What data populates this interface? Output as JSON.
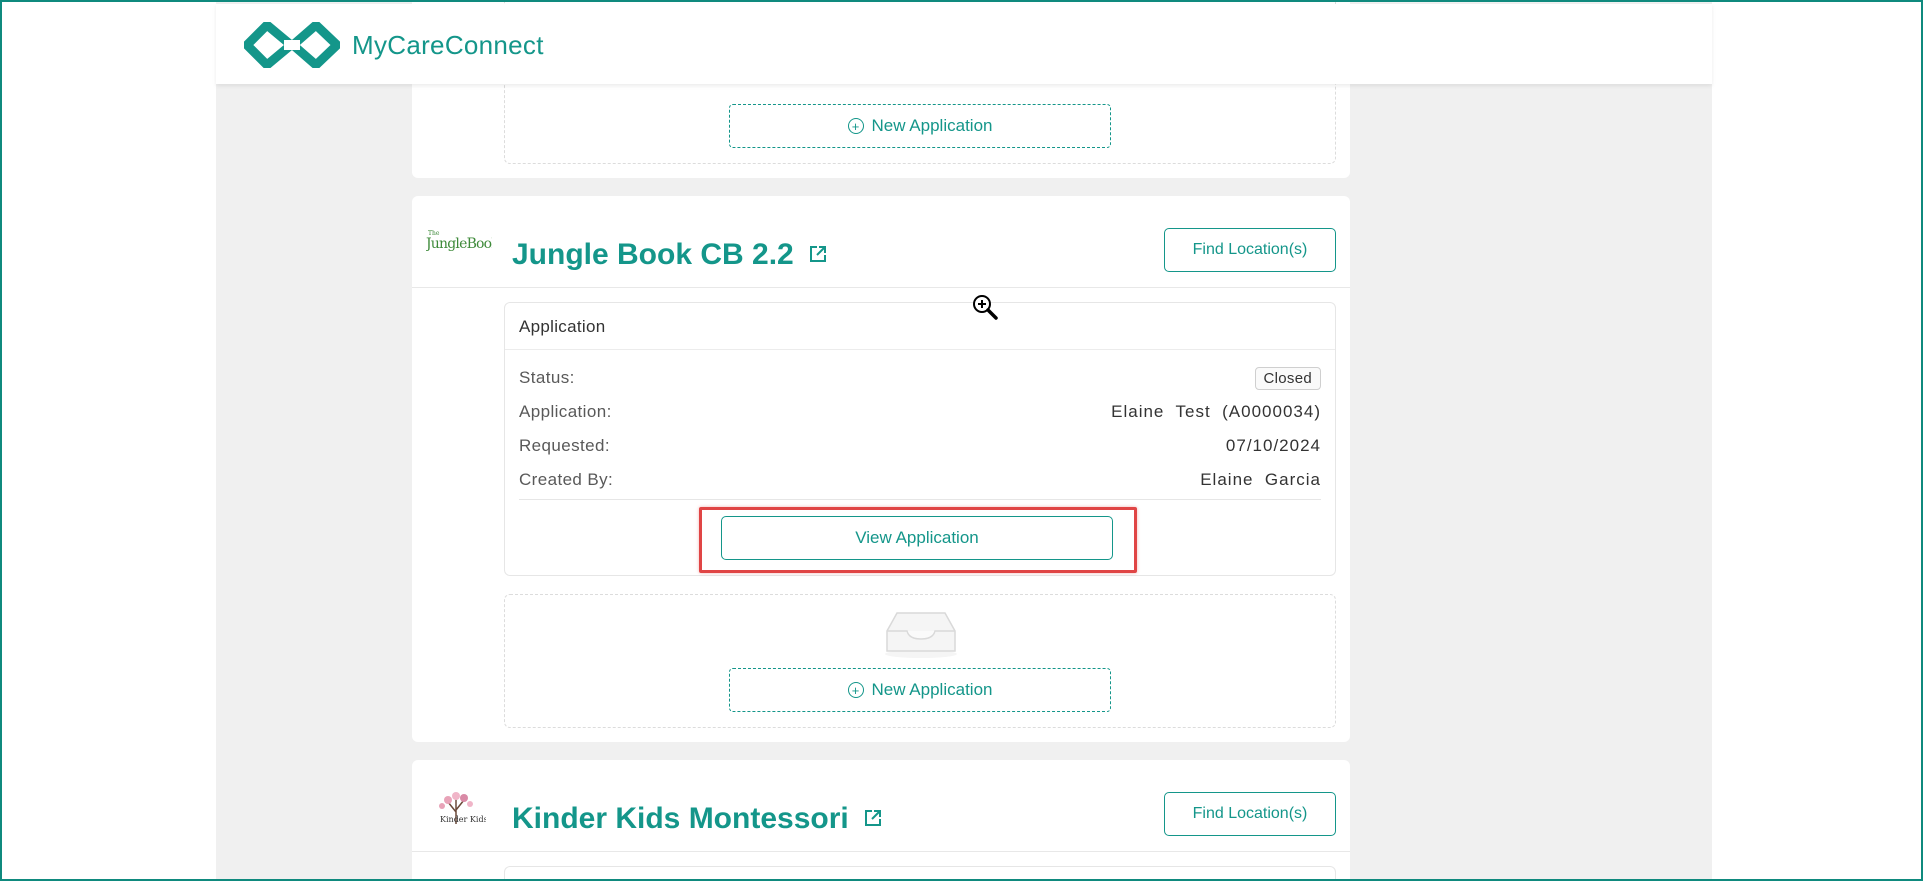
{
  "header": {
    "app_name": "MyCareConnect",
    "brand_color": "#14968a"
  },
  "top_card": {
    "new_application_label": "New Application"
  },
  "providers": [
    {
      "logo_text": "The JungleBook",
      "title": "Jungle Book CB 2.2",
      "find_locations_label": "Find Location(s)",
      "application": {
        "panel_title": "Application",
        "status_label": "Status:",
        "status_value": "Closed",
        "application_label": "Application:",
        "application_value": "Elaine  Test  (A0000034)",
        "requested_label": "Requested:",
        "requested_value": "07/10/2024",
        "created_by_label": "Created By:",
        "created_by_value": "Elaine  Garcia",
        "view_button_label": "View Application"
      },
      "new_application_label": "New Application"
    },
    {
      "logo_text": "Kinder Kids",
      "title": "Kinder Kids Montessori",
      "find_locations_label": "Find Location(s)"
    }
  ],
  "annotation": {
    "highlight_color": "#e04545"
  }
}
